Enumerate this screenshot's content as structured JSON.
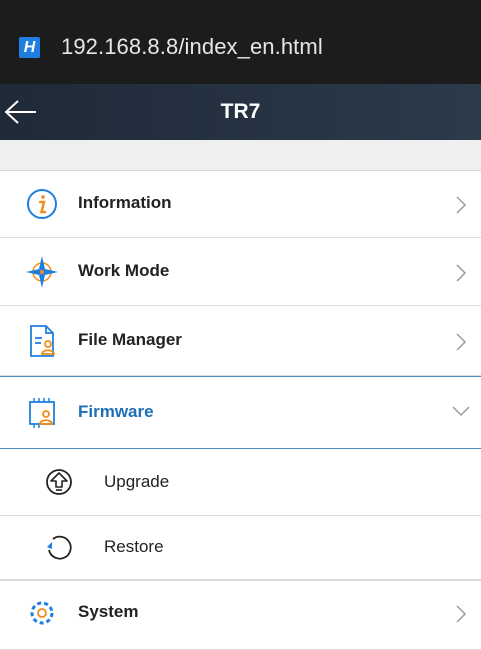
{
  "browser": {
    "badge": "H",
    "url": "192.168.8.8/index_en.html"
  },
  "appbar": {
    "title": "TR7"
  },
  "menu": {
    "information": {
      "label": "Information",
      "icon": "info-icon"
    },
    "work_mode": {
      "label": "Work Mode",
      "icon": "compass-icon"
    },
    "file_manager": {
      "label": "File Manager",
      "icon": "file-manager-icon"
    },
    "firmware": {
      "label": "Firmware",
      "icon": "firmware-icon",
      "expanded": true
    },
    "upgrade": {
      "label": "Upgrade",
      "icon": "upgrade-icon"
    },
    "restore": {
      "label": "Restore",
      "icon": "restore-icon"
    },
    "system": {
      "label": "System",
      "icon": "gear-icon"
    }
  },
  "colors": {
    "accent": "#1d6fb8",
    "icon_orange": "#f08c1a",
    "icon_blue": "#1f7fe0"
  }
}
